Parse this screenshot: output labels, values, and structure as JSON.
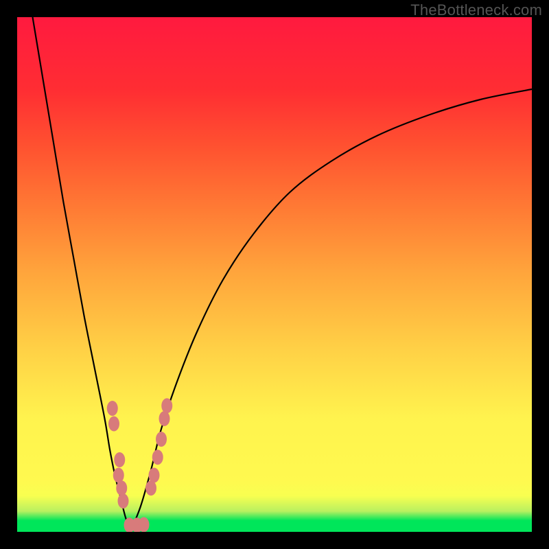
{
  "watermark": "TheBottleneck.com",
  "colors": {
    "frame": "#000000",
    "curve": "#000000",
    "bead": "#d87b7b",
    "gradient_top": "#ff1a3f",
    "gradient_bottom": "#00e65a"
  },
  "chart_data": {
    "type": "line",
    "title": "",
    "xlabel": "",
    "ylabel": "",
    "xlim": [
      0,
      100
    ],
    "ylim": [
      0,
      100
    ],
    "note": "Axes are unlabeled; values are estimated from pixel positions on a 0–100 normalized scale (origin at bottom-left of the colored plot area). The figure shows a V-shaped bottleneck curve touching ~0 near x≈22, with scattered pink markers clustered on both arms near the minimum.",
    "series": [
      {
        "name": "left-arm",
        "x": [
          3,
          5,
          7,
          9,
          11,
          13,
          15,
          17,
          18,
          19,
          20,
          21,
          22
        ],
        "y": [
          100,
          88,
          76,
          64,
          53,
          42,
          32,
          22,
          16,
          11,
          7,
          3,
          0
        ]
      },
      {
        "name": "right-arm",
        "x": [
          22,
          24,
          26,
          28,
          31,
          35,
          40,
          46,
          53,
          61,
          70,
          80,
          90,
          100
        ],
        "y": [
          0,
          5,
          12,
          20,
          29,
          39,
          49,
          58,
          66,
          72,
          77,
          81,
          84,
          86
        ]
      }
    ],
    "scatter": {
      "name": "markers",
      "points": [
        {
          "x": 18.5,
          "y": 24
        },
        {
          "x": 18.8,
          "y": 21
        },
        {
          "x": 19.9,
          "y": 14
        },
        {
          "x": 19.7,
          "y": 11
        },
        {
          "x": 20.3,
          "y": 8.5
        },
        {
          "x": 20.6,
          "y": 6
        },
        {
          "x": 21.8,
          "y": 1.3
        },
        {
          "x": 23.3,
          "y": 1.3
        },
        {
          "x": 24.6,
          "y": 1.4
        },
        {
          "x": 26.0,
          "y": 8.5
        },
        {
          "x": 26.6,
          "y": 11
        },
        {
          "x": 27.3,
          "y": 14.5
        },
        {
          "x": 28.0,
          "y": 18
        },
        {
          "x": 28.6,
          "y": 22
        },
        {
          "x": 29.1,
          "y": 24.5
        }
      ]
    }
  }
}
